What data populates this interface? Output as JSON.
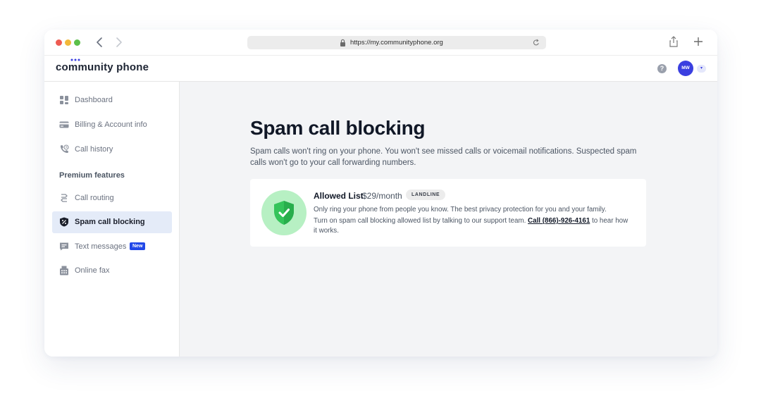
{
  "browser": {
    "url": "https://my.communityphone.org"
  },
  "topbar": {
    "logo": "community phone",
    "help": "?",
    "avatar_initials": "MW"
  },
  "sidebar": {
    "items": [
      {
        "label": "Dashboard",
        "icon": "dashboard-icon"
      },
      {
        "label": "Billing & Account info",
        "icon": "credit-card-icon"
      },
      {
        "label": "Call history",
        "icon": "phone-history-icon"
      }
    ],
    "section_heading": "Premium features",
    "premium_items": [
      {
        "label": "Call routing",
        "icon": "routing-icon"
      },
      {
        "label": "Spam call blocking",
        "icon": "spam-shield-icon",
        "active": true
      },
      {
        "label": "Text messages",
        "icon": "message-icon",
        "badge": "New"
      },
      {
        "label": "Online fax",
        "icon": "fax-icon"
      }
    ]
  },
  "main": {
    "title": "Spam call blocking",
    "description": "Spam calls won't ring on your phone. You won't see missed calls or voicemail notifications.  Suspected spam calls won't go to your call forwarding numbers.",
    "card": {
      "title": "Allowed List",
      "price": "$29/month",
      "tag": "LANDLINE",
      "line1": "Only ring your phone from people you know. The best privacy protection for you and your family.",
      "line2_before": "Turn on spam call blocking allowed list by talking to our support team. ",
      "call_link": "Call (866)-926-4161",
      "line2_after": " to hear how it works."
    }
  },
  "colors": {
    "accent": "#2148e8",
    "avatar": "#3a3fe0",
    "shield_green": "#2fbf55",
    "active_bg": "#e4ebf8"
  }
}
